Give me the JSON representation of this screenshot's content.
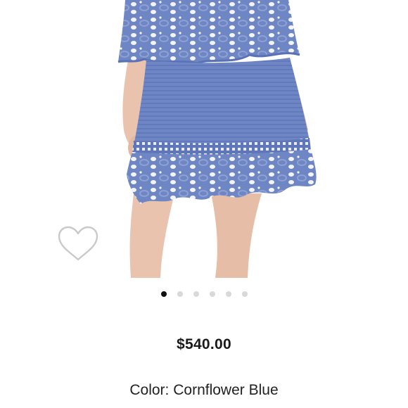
{
  "product": {
    "price": "$540.00",
    "color_label": "Color:",
    "color_value": "Cornflower Blue"
  },
  "gallery": {
    "slide_count": 6,
    "active_slide": 1
  },
  "colors": {
    "fabric": "#6f86c4",
    "fabric_dark": "#4d64a6",
    "skin": "#e9c3ae",
    "heart_outline": "#c9c9c9",
    "dot_active": "#111111",
    "dot_inactive": "#d9d9d9"
  },
  "icons": {
    "wishlist": "heart-outline-icon"
  }
}
